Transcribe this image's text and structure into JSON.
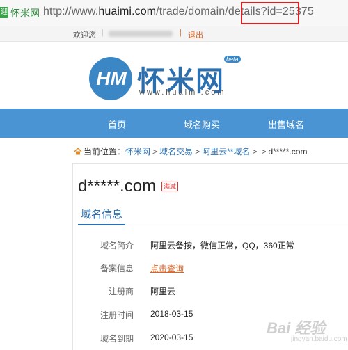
{
  "browser": {
    "site_icon": "迎",
    "site_name": "怀米网",
    "url_prefix": "http://www.",
    "url_host": "huaimi.com",
    "url_path": "/trade/domain/details?id=25375"
  },
  "topbar": {
    "welcome": "欢迎您",
    "separator": "|",
    "logout": "退出"
  },
  "logo": {
    "mark": "HM",
    "name": "怀米网",
    "beta": "beta",
    "url": "www.huaimi.com"
  },
  "nav": {
    "items": [
      "首页",
      "域名购买",
      "出售域名"
    ]
  },
  "breadcrumb": {
    "label": "当前位置：",
    "items": [
      "怀米网",
      "域名交易",
      "阿里云**域名"
    ],
    "separator": ">",
    "current": "d*****.com"
  },
  "domain": {
    "name": "d*****.com",
    "tag": "满减"
  },
  "tab": {
    "label": "域名信息"
  },
  "details": [
    {
      "label": "域名简介",
      "value": "阿里云备按，微信正常，QQ，360正常"
    },
    {
      "label": "备案信息",
      "value": "点击查询"
    },
    {
      "label": "注册商",
      "value": "阿里云"
    },
    {
      "label": "注册时间",
      "value": "2018-03-15"
    },
    {
      "label": "域名到期",
      "value": "2020-03-15"
    }
  ],
  "watermark": {
    "text": "Bai 经验",
    "sub": "jingyan.baidu.com"
  },
  "colors": {
    "nav": "#4a94d3",
    "highlight": "#e02020",
    "link": "#2a6fb0",
    "accent": "#e0621f"
  }
}
